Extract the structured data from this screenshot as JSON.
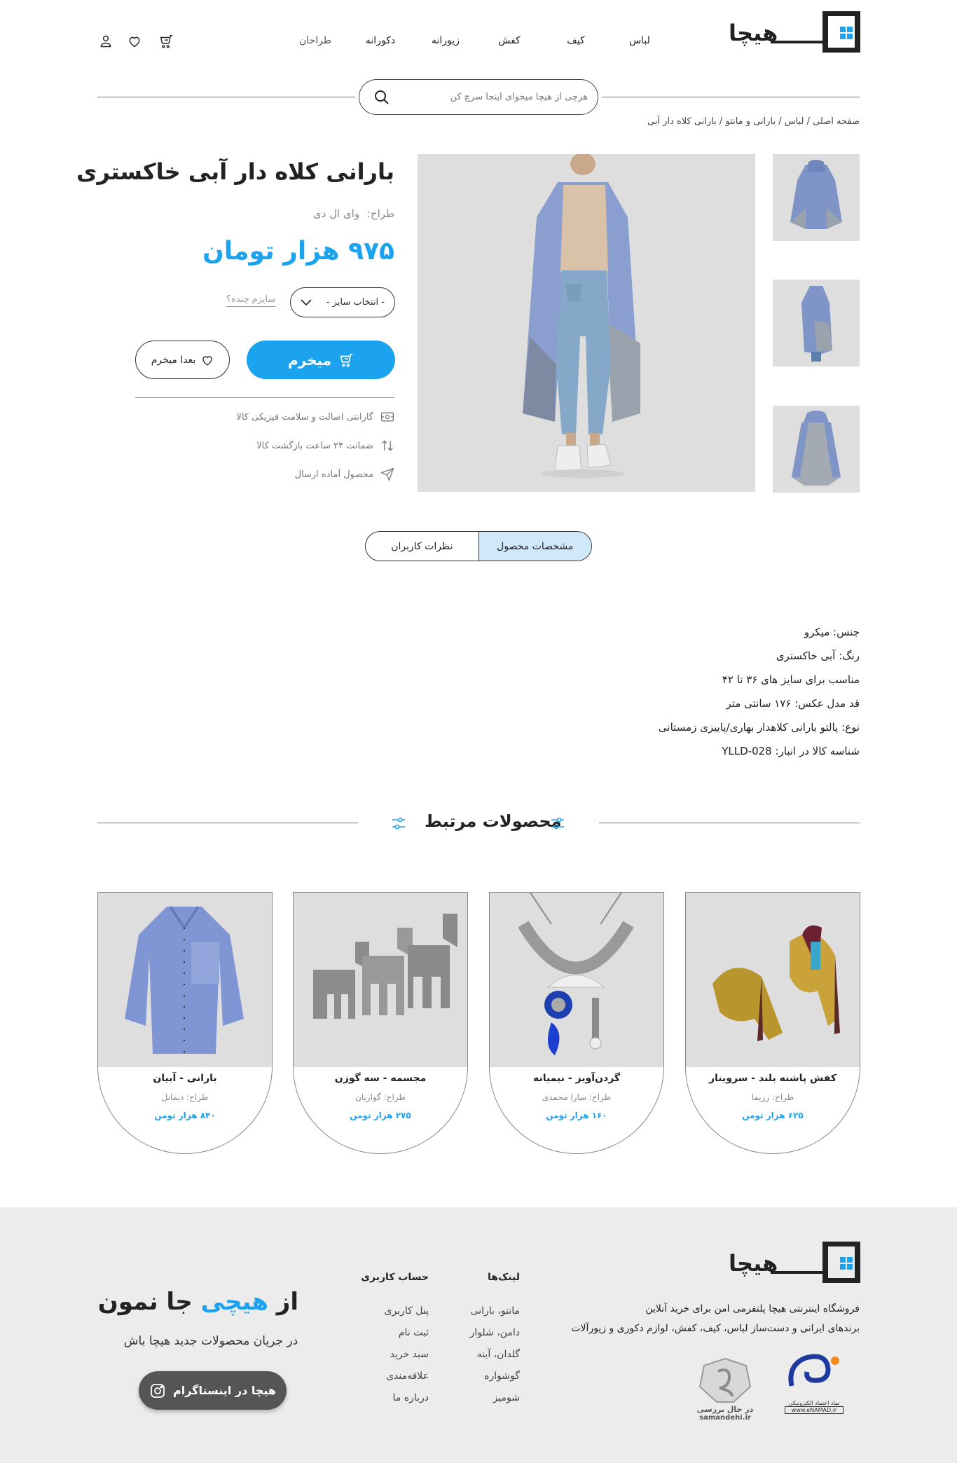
{
  "header": {
    "brand": "هیچا",
    "nav": [
      "لباس",
      "کیف",
      "کفش",
      "زیورانه",
      "دکورانه",
      "طراحان"
    ],
    "search_placeholder": "هرچی از هیچا میخوای اینجا سرچ کن"
  },
  "breadcrumb": [
    "صفحه اصلی",
    "لباس",
    "بارانی و مانتو",
    "بارانی کلاه دار آبی"
  ],
  "breadcrumb_text": "صفحه اصلی / لباس / بارانی و مانتو / بارانی کلاه دار آبی",
  "product": {
    "title": "بارانی کلاه دار آبی خاکستری",
    "designer_label": "طراح:",
    "designer": "وای ال دی",
    "price": "۹۷۵ هزار تومان",
    "size_select": "- انتخاب سایز -",
    "size_guide": "سایزم چنده؟",
    "buy_label": "میخرم",
    "later_label": "بعدا میخرم",
    "features": [
      {
        "icon": "badge-icon",
        "text": "گارانتی اصالت و سلامت فیزیکی کالا"
      },
      {
        "icon": "arrows-icon",
        "text": "ضمانت ۲۴ ساعت بازگشت کالا"
      },
      {
        "icon": "send-icon",
        "text": "محصول آماده ارسال"
      }
    ]
  },
  "tabs": {
    "specs": "مشخصات محصول",
    "reviews": "نظرات کاربران"
  },
  "specs": [
    "جنس: میکرو",
    "رنگ: آبی خاکستری",
    "مناسب برای سایز های ۳۶ تا ۴۲",
    "قد مدل عکس: ۱۷۶ سانتی متر",
    "نوع: پالتو بارانی کلاهدار بهاری/پاییزی زمستانی",
    "شناسه کالا در انبار: YLLD-028"
  ],
  "related": {
    "title": "محصولات مرتبط",
    "items": [
      {
        "name": "کفش پاشنه بلند - سروینار",
        "designer": "طراح: رزیما",
        "price": "۶۲۵ هزار تومن"
      },
      {
        "name": "گردن‌آویز - نیمیانه",
        "designer": "طراح: سارا محمدی",
        "price": "۱۶۰ هزار تومن"
      },
      {
        "name": "مجسمه - سه گوزن",
        "designer": "طراح: گواریان",
        "price": "۲۷۵ هزار تومن"
      },
      {
        "name": "بارانی - آبیان",
        "designer": "طراح: دیمانل",
        "price": "۸۴۰ هزار تومن"
      }
    ]
  },
  "footer": {
    "desc1": "فروشگاه اینترنتی هیچا پلتفرمی امن برای خرید آنلاین",
    "desc2": "برندهای ایرانی و دست‌ساز لباس، کیف، کفش، لوازم دکوری و زیورآلات",
    "links_title": "لینک‌ها",
    "links": [
      "مانتو، بارانی",
      "دامن، شلوار",
      "گلدان، آینه",
      "گوشواره",
      "شومیز"
    ],
    "account_title": "حساب کاربری",
    "account": [
      "پنل کاربری",
      "ثبت نام",
      "سبد خرید",
      "علاقه‌مندی",
      "درباره ما"
    ],
    "insta_from": "از",
    "insta_brand": "هیچی",
    "insta_rest": "جا نمون",
    "insta_sub": "در جریان محصولات جدید هیچا باش",
    "insta_btn": "هیچا در اینستاگرام",
    "enamad_text": "نماد اعتماد الکترونیکی",
    "enamad_url": "www.eNAMAD.ir",
    "samandehi_status": "در حال بررسی",
    "samandehi_url": "samandehi.ir"
  },
  "colors": {
    "accent": "#1ba3f0",
    "accent_light": "#cfe9fb",
    "image_bg": "#dedede",
    "footer_bg": "#ececec"
  }
}
